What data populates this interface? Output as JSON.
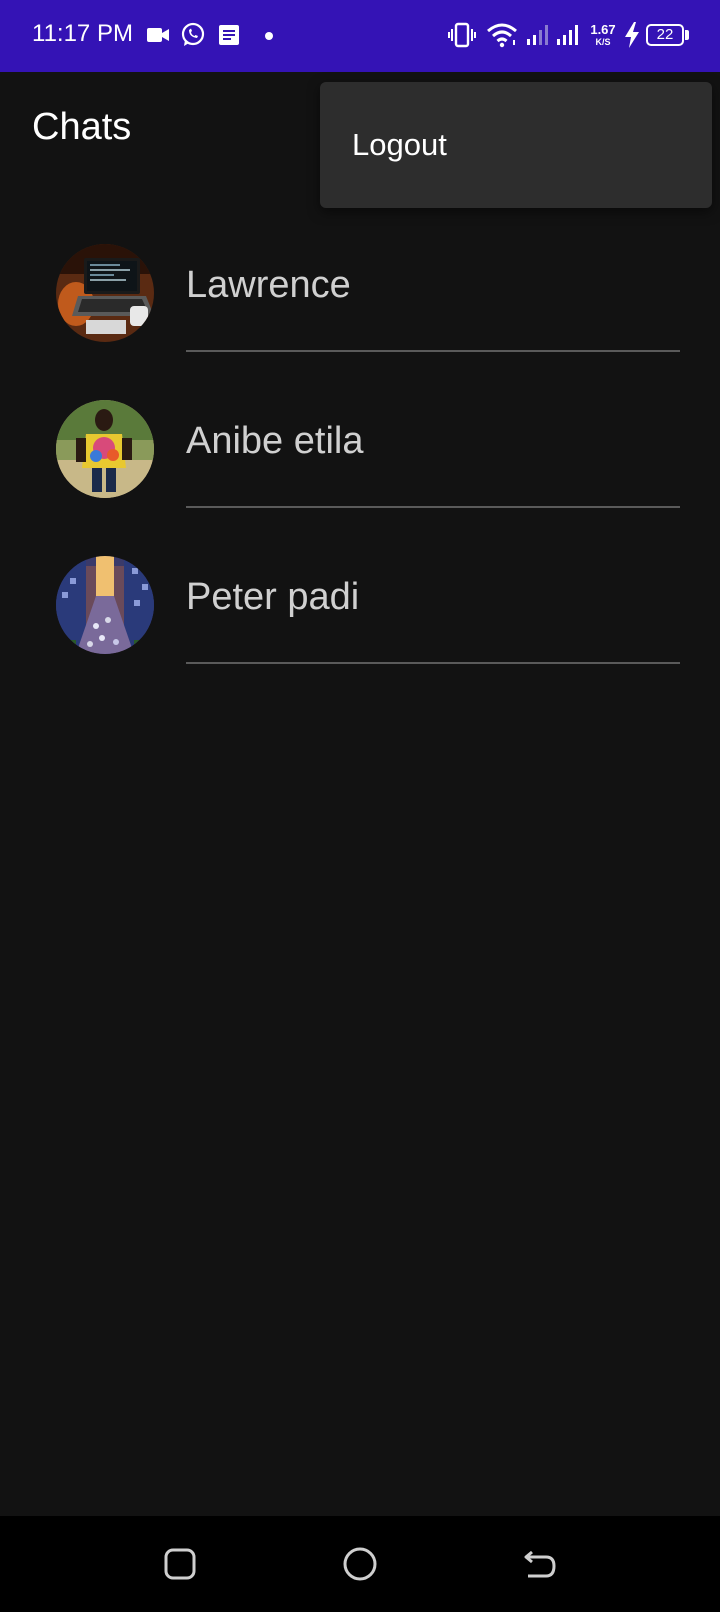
{
  "status_bar": {
    "time": "11:17 PM",
    "net_speed_value": "1.67",
    "net_speed_unit": "K/S",
    "battery_level": "22",
    "background_color": "#3413b5",
    "icons": [
      "video-camera-icon",
      "whatsapp-icon",
      "message-icon",
      "notification-dot-icon",
      "vibrate-icon",
      "wifi-icon",
      "signal-icon",
      "signal-icon",
      "charging-icon",
      "battery-icon"
    ]
  },
  "app_bar": {
    "title": "Chats"
  },
  "menu": {
    "items": [
      {
        "label": "Logout"
      }
    ]
  },
  "chats": [
    {
      "name": "Lawrence",
      "avatar": "laptop-photo"
    },
    {
      "name": "Anibe etila",
      "avatar": "person-tie-dye-shirt-photo"
    },
    {
      "name": "Peter padi",
      "avatar": "city-street-photo"
    }
  ],
  "nav_bar": {
    "buttons": [
      "recents-icon",
      "home-icon",
      "back-icon"
    ]
  },
  "colors": {
    "background": "#121212",
    "menu_background": "#2d2d2d",
    "divider": "#5a5a5a",
    "chat_name": "#d0d0d0"
  }
}
